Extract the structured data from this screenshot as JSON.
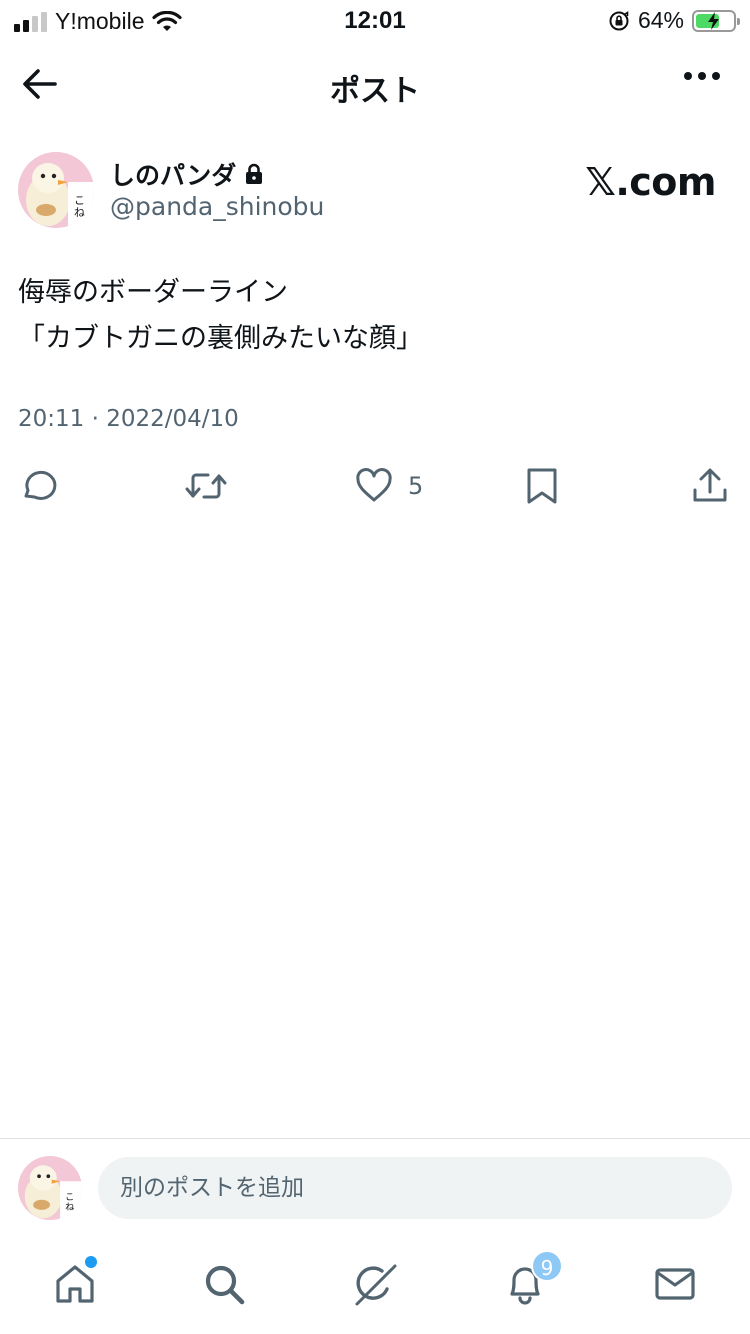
{
  "status_bar": {
    "carrier": "Y!mobile",
    "time": "12:01",
    "battery_percent": "64%",
    "battery_level": 0.64,
    "signal_bars": 4,
    "signal_bars_active": 2
  },
  "header": {
    "title": "ポスト"
  },
  "post": {
    "author_name": "しのパンダ",
    "author_handle": "@panda_shinobu",
    "source_watermark": "𝕏.com",
    "text_lines": [
      "侮辱のボーダーライン",
      "「カブトガニの裏側みたいな顔」"
    ],
    "timestamp": "20:11 · 2022/04/10",
    "like_count": "5"
  },
  "reply": {
    "placeholder": "別のポストを追加"
  },
  "tabbar": {
    "notification_badge": "9"
  },
  "colors": {
    "text": "#0f1419",
    "muted": "#536471",
    "accent": "#1d9bf0",
    "battery": "#4cd964"
  }
}
